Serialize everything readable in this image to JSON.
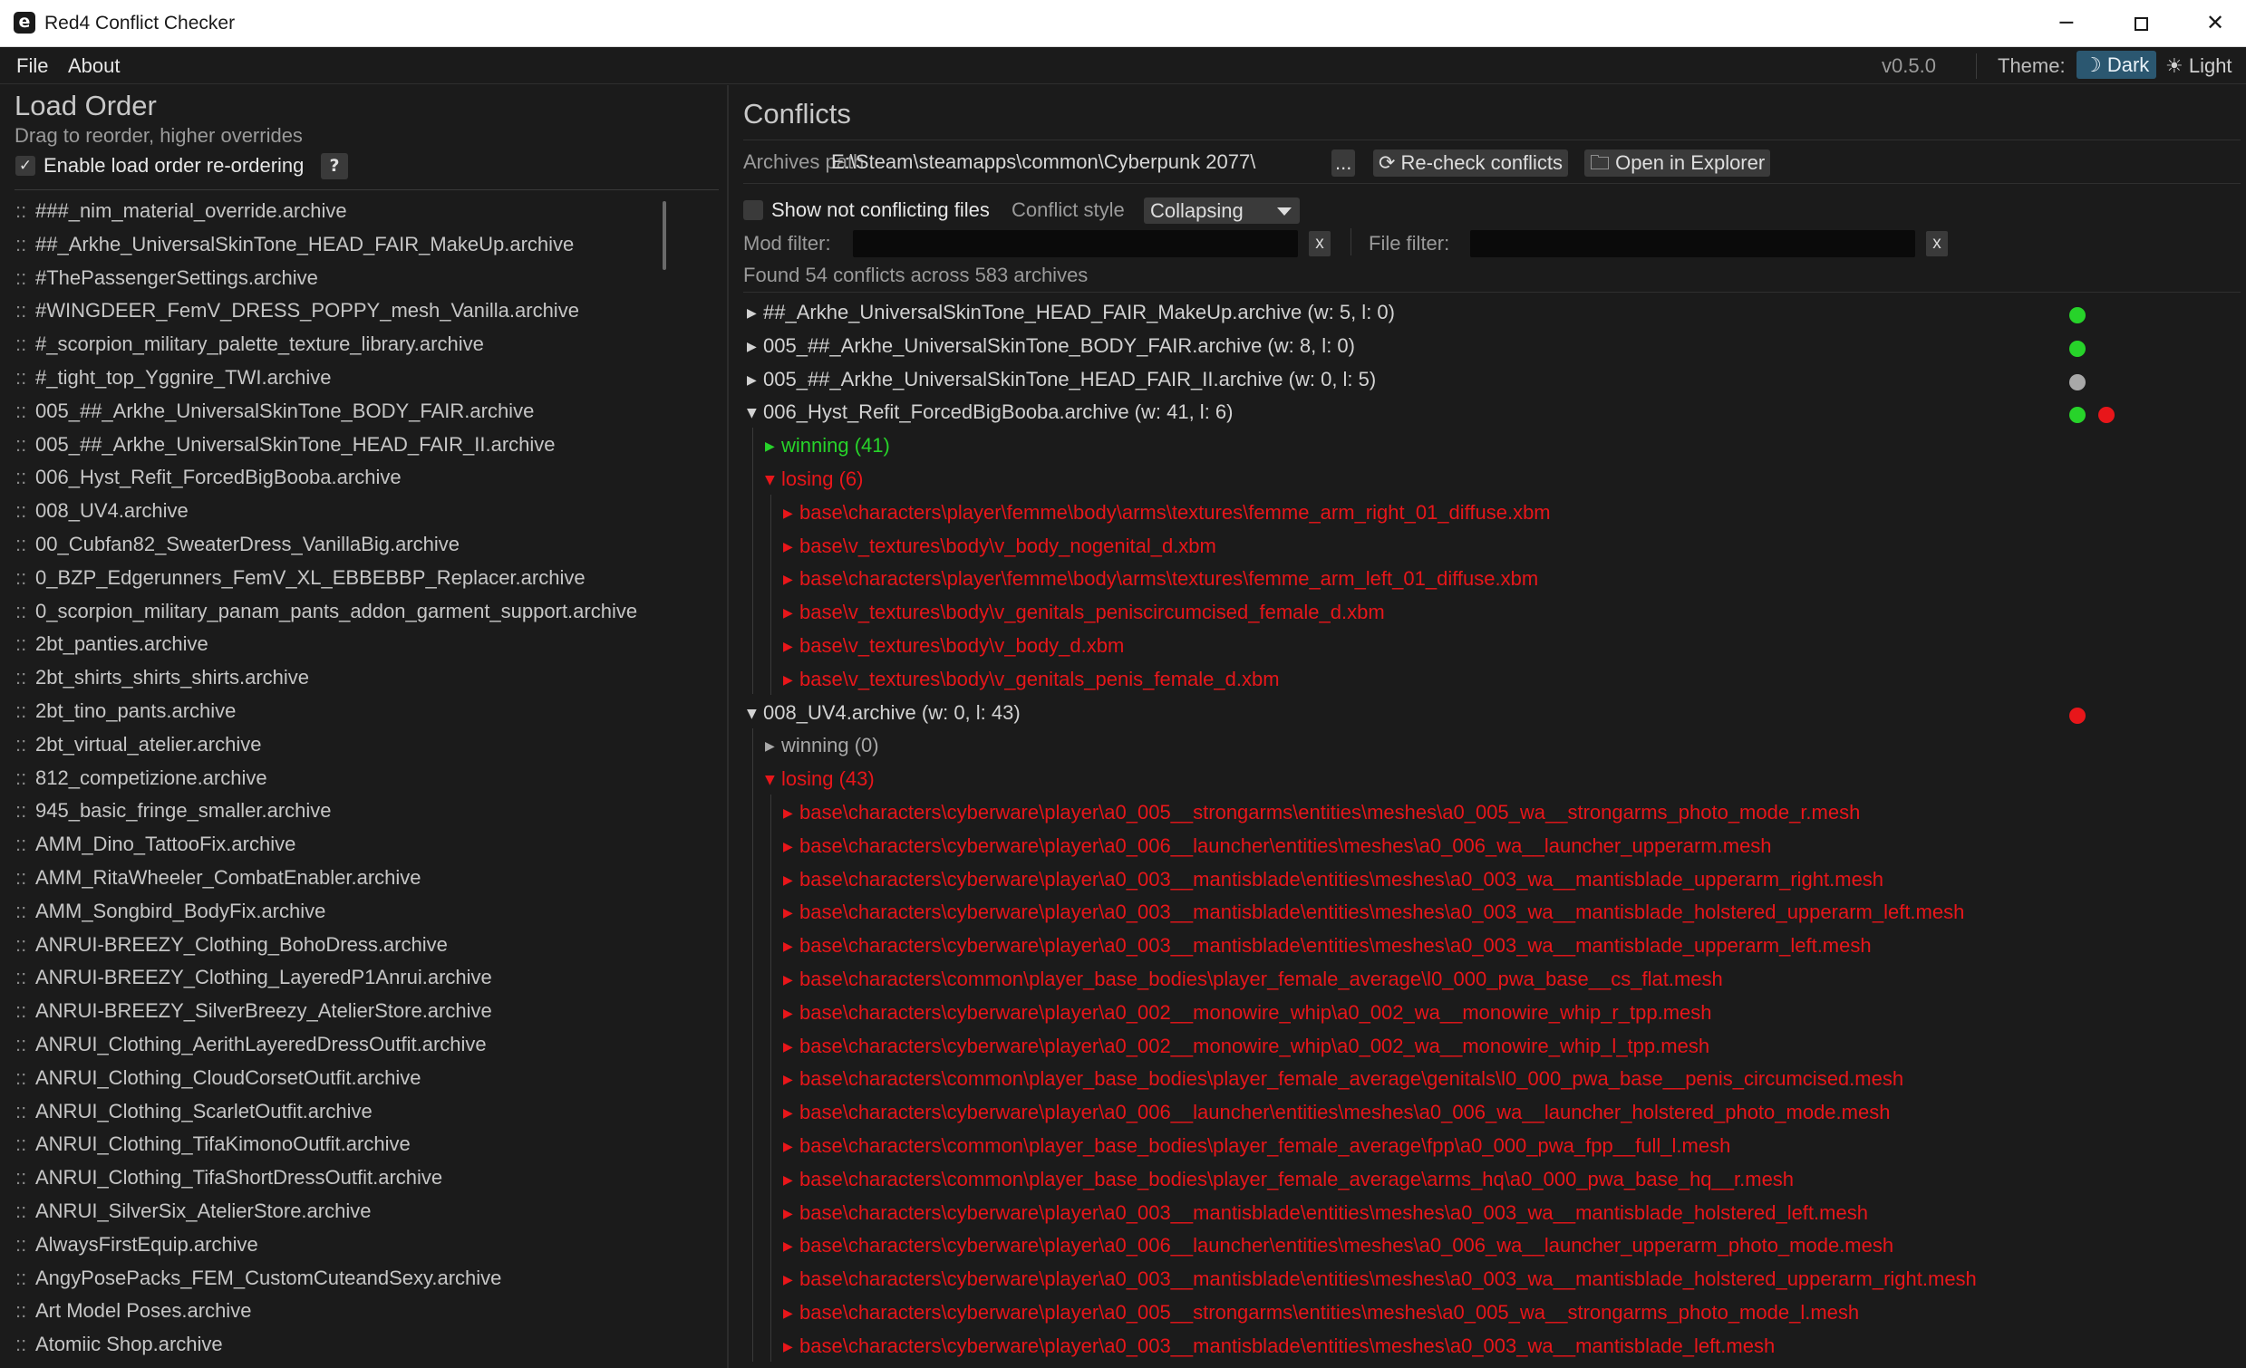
{
  "window": {
    "title": "Red4 Conflict Checker",
    "app_icon": "e",
    "min_glyph": "─",
    "close_glyph": "✕"
  },
  "menu": {
    "file": "File",
    "about": "About",
    "version": "v0.5.0",
    "theme_label": "Theme:",
    "theme_dark": "☽ Dark",
    "theme_light": "☀ Light"
  },
  "load_order": {
    "title": "Load Order",
    "subtitle": "Drag to reorder, higher overrides",
    "enable_label": "Enable load order re-ordering",
    "enable_checked": true,
    "checkmark": "✓",
    "help": "?",
    "handle": "::",
    "items": [
      "###_nim_material_override.archive",
      "##_Arkhe_UniversalSkinTone_HEAD_FAIR_MakeUp.archive",
      "#ThePassengerSettings.archive",
      "#WINGDEER_FemV_DRESS_POPPY_mesh_Vanilla.archive",
      "#_scorpion_military_palette_texture_library.archive",
      "#_tight_top_Yggnire_TWI.archive",
      "005_##_Arkhe_UniversalSkinTone_BODY_FAIR.archive",
      "005_##_Arkhe_UniversalSkinTone_HEAD_FAIR_II.archive",
      "006_Hyst_Refit_ForcedBigBooba.archive",
      "008_UV4.archive",
      "00_Cubfan82_SweaterDress_VanillaBig.archive",
      "0_BZP_Edgerunners_FemV_XL_EBBEBBP_Replacer.archive",
      "0_scorpion_military_panam_pants_addon_garment_support.archive",
      "2bt_panties.archive",
      "2bt_shirts_shirts_shirts.archive",
      "2bt_tino_pants.archive",
      "2bt_virtual_atelier.archive",
      "812_competizione.archive",
      "945_basic_fringe_smaller.archive",
      "AMM_Dino_TattooFix.archive",
      "AMM_RitaWheeler_CombatEnabler.archive",
      "AMM_Songbird_BodyFix.archive",
      "ANRUI-BREEZY_Clothing_BohoDress.archive",
      "ANRUI-BREEZY_Clothing_LayeredP1Anrui.archive",
      "ANRUI-BREEZY_SilverBreezy_AtelierStore.archive",
      "ANRUI_Clothing_AerithLayeredDressOutfit.archive",
      "ANRUI_Clothing_CloudCorsetOutfit.archive",
      "ANRUI_Clothing_ScarletOutfit.archive",
      "ANRUI_Clothing_TifaKimonoOutfit.archive",
      "ANRUI_Clothing_TifaShortDressOutfit.archive",
      "ANRUI_SilverSix_AtelierStore.archive",
      "AlwaysFirstEquip.archive",
      "AngyPosePacks_FEM_CustomCuteandSexy.archive",
      "Art Model Poses.archive",
      "Atomiic Shop.archive"
    ]
  },
  "conflicts": {
    "title": "Conflicts",
    "archives_path_label": "Archives path",
    "archives_path_value": "E:\\Steam\\steamapps\\common\\Cyberpunk 2077\\",
    "browse_button": "...",
    "recheck_button": "⟳ Re-check conflicts",
    "explorer_button": "🗀 Open in Explorer",
    "show_not_conflicting_label": "Show not conflicting files",
    "show_not_conflicting_checked": false,
    "conflict_style_label": "Conflict style",
    "conflict_style_value": "Collapsing",
    "mod_filter_label": "Mod filter:",
    "mod_filter_value": "",
    "file_filter_label": "File filter:",
    "file_filter_value": "",
    "clear_glyph": "x",
    "summary": "Found 54 conflicts across 583 archives",
    "arrow_collapsed": "▶",
    "arrow_expanded": "▼",
    "status_colors": {
      "win": "#27d32a",
      "lose": "#e8161a",
      "neutral": "#a8a8a8"
    },
    "archives": [
      {
        "name": "##_Arkhe_UniversalSkinTone_HEAD_FAIR_MakeUp.archive (w: 5, l: 0)",
        "expanded": false,
        "status": [
          "win"
        ]
      },
      {
        "name": "005_##_Arkhe_UniversalSkinTone_BODY_FAIR.archive (w: 8, l: 0)",
        "expanded": false,
        "status": [
          "win"
        ]
      },
      {
        "name": "005_##_Arkhe_UniversalSkinTone_HEAD_FAIR_II.archive (w: 0, l: 5)",
        "expanded": false,
        "status": [
          "neutral"
        ]
      },
      {
        "name": "006_Hyst_Refit_ForcedBigBooba.archive (w: 41, l: 6)",
        "expanded": true,
        "status": [
          "win",
          "lose"
        ],
        "winning": {
          "label": "winning (41)",
          "expanded": false,
          "files": []
        },
        "losing": {
          "label": "losing (6)",
          "expanded": true,
          "files": [
            "base\\characters\\player\\femme\\body\\arms\\textures\\femme_arm_right_01_diffuse.xbm",
            "base\\v_textures\\body\\v_body_nogenital_d.xbm",
            "base\\characters\\player\\femme\\body\\arms\\textures\\femme_arm_left_01_diffuse.xbm",
            "base\\v_textures\\body\\v_genitals_peniscircumcised_female_d.xbm",
            "base\\v_textures\\body\\v_body_d.xbm",
            "base\\v_textures\\body\\v_genitals_penis_female_d.xbm"
          ]
        }
      },
      {
        "name": "008_UV4.archive (w: 0, l: 43)",
        "expanded": true,
        "status": [
          "lose"
        ],
        "winning": {
          "label": "winning (0)",
          "expanded": false,
          "files": []
        },
        "losing": {
          "label": "losing (43)",
          "expanded": true,
          "files": [
            "base\\characters\\cyberware\\player\\a0_005__strongarms\\entities\\meshes\\a0_005_wa__strongarms_photo_mode_r.mesh",
            "base\\characters\\cyberware\\player\\a0_006__launcher\\entities\\meshes\\a0_006_wa__launcher_upperarm.mesh",
            "base\\characters\\cyberware\\player\\a0_003__mantisblade\\entities\\meshes\\a0_003_wa__mantisblade_upperarm_right.mesh",
            "base\\characters\\cyberware\\player\\a0_003__mantisblade\\entities\\meshes\\a0_003_wa__mantisblade_holstered_upperarm_left.mesh",
            "base\\characters\\cyberware\\player\\a0_003__mantisblade\\entities\\meshes\\a0_003_wa__mantisblade_upperarm_left.mesh",
            "base\\characters\\common\\player_base_bodies\\player_female_average\\l0_000_pwa_base__cs_flat.mesh",
            "base\\characters\\cyberware\\player\\a0_002__monowire_whip\\a0_002_wa__monowire_whip_r_tpp.mesh",
            "base\\characters\\cyberware\\player\\a0_002__monowire_whip\\a0_002_wa__monowire_whip_l_tpp.mesh",
            "base\\characters\\common\\player_base_bodies\\player_female_average\\genitals\\l0_000_pwa_base__penis_circumcised.mesh",
            "base\\characters\\cyberware\\player\\a0_006__launcher\\entities\\meshes\\a0_006_wa__launcher_holstered_photo_mode.mesh",
            "base\\characters\\common\\player_base_bodies\\player_female_average\\fpp\\a0_000_pwa_fpp__full_l.mesh",
            "base\\characters\\common\\player_base_bodies\\player_female_average\\arms_hq\\a0_000_pwa_base_hq__r.mesh",
            "base\\characters\\cyberware\\player\\a0_003__mantisblade\\entities\\meshes\\a0_003_wa__mantisblade_holstered_left.mesh",
            "base\\characters\\cyberware\\player\\a0_006__launcher\\entities\\meshes\\a0_006_wa__launcher_upperarm_photo_mode.mesh",
            "base\\characters\\cyberware\\player\\a0_003__mantisblade\\entities\\meshes\\a0_003_wa__mantisblade_holstered_upperarm_right.mesh",
            "base\\characters\\cyberware\\player\\a0_005__strongarms\\entities\\meshes\\a0_005_wa__strongarms_photo_mode_l.mesh",
            "base\\characters\\cyberware\\player\\a0_003__mantisblade\\entities\\meshes\\a0_003_wa__mantisblade_left.mesh"
          ]
        }
      }
    ]
  }
}
